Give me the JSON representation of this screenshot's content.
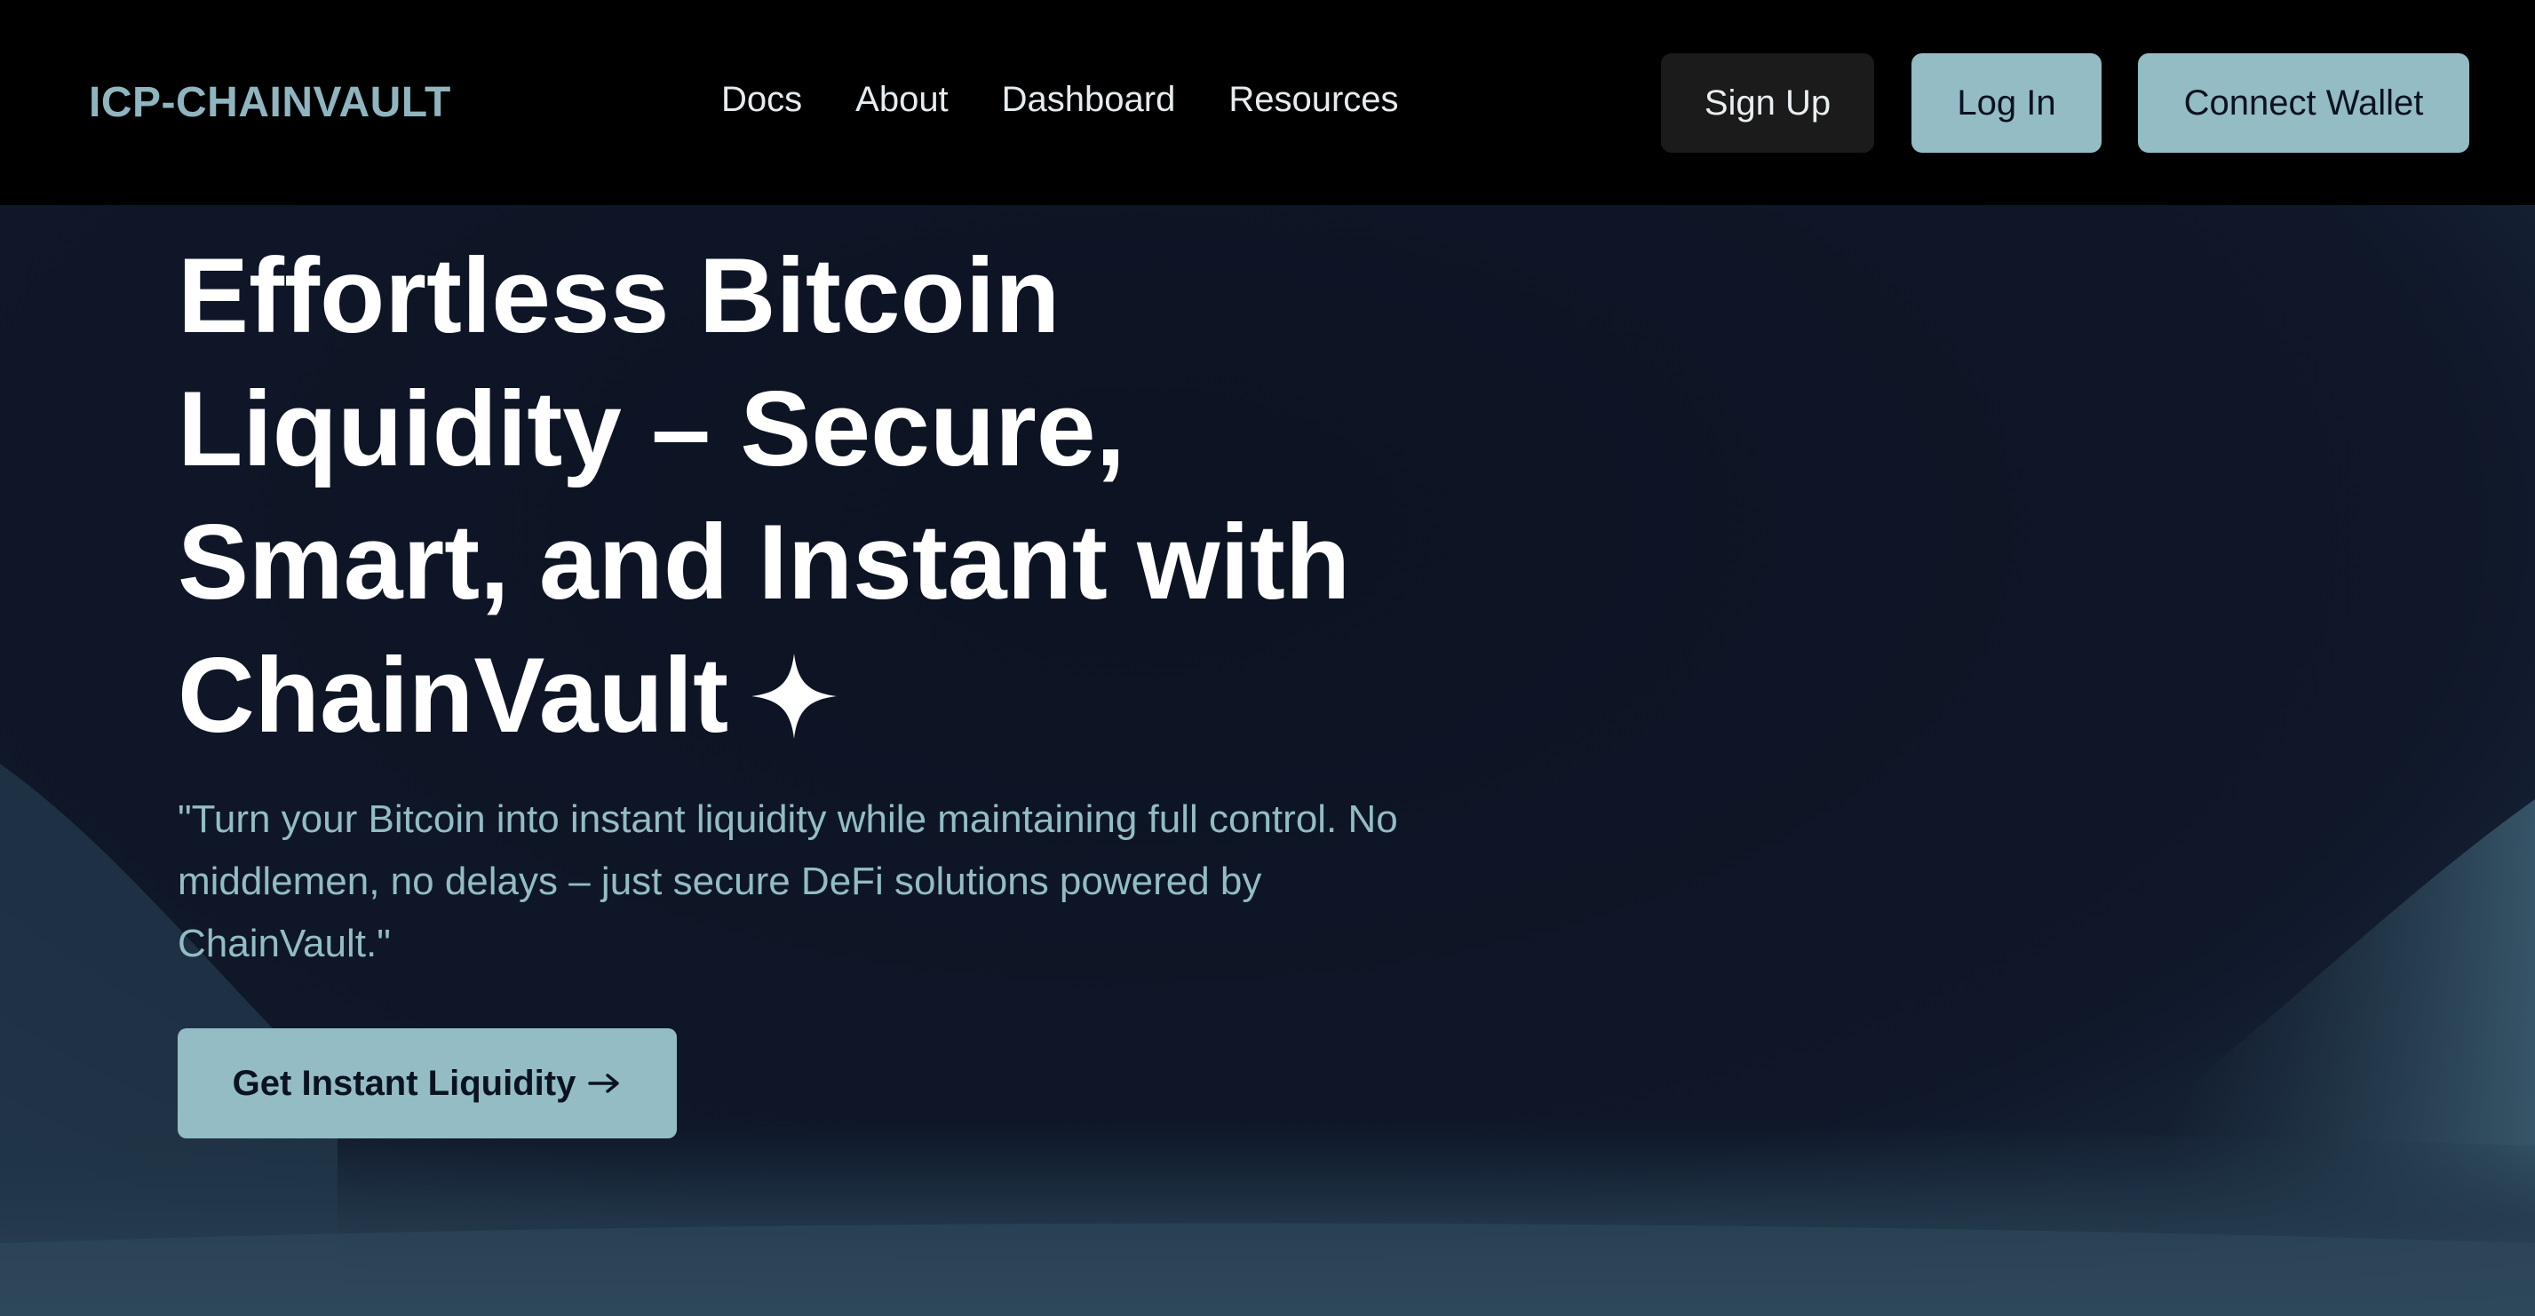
{
  "nav": {
    "logo": "ICP-CHAINVAULT",
    "links": [
      "Docs",
      "About",
      "Dashboard",
      "Resources"
    ],
    "signup_label": "Sign Up",
    "login_label": "Log In",
    "wallet_label": "Connect Wallet"
  },
  "hero": {
    "title": "Effortless Bitcoin Liquidity – Secure, Smart, and Instant with ChainVault",
    "title_icon": "sparkle-icon",
    "subtitle": "\"Turn your Bitcoin into instant liquidity while maintaining full control. No middlemen, no delays – just secure DeFi solutions powered by ChainVault.\"",
    "cta_label": "Get Instant Liquidity",
    "cta_icon": "arrow-right-icon"
  },
  "colors": {
    "accent": "#93bcc4",
    "nav_bg": "#000000",
    "hero_bg": "#0f1729",
    "text": "#ffffff"
  }
}
